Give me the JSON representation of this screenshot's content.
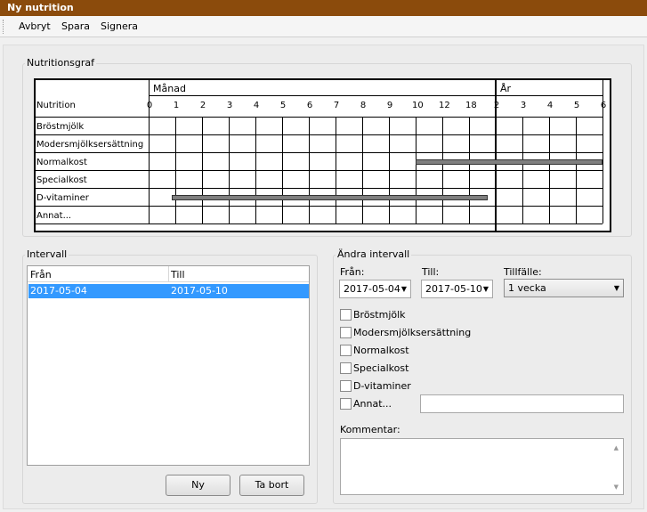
{
  "window": {
    "title": "Ny nutrition"
  },
  "menu": {
    "cancel": "Avbryt",
    "save": "Spara",
    "sign": "Signera"
  },
  "graph": {
    "legend": "Nutritionsgraf",
    "month_header": "Månad",
    "year_header": "År",
    "row_header": "Nutrition",
    "month_ticks": [
      "0",
      "1",
      "2",
      "3",
      "4",
      "5",
      "6",
      "7",
      "8",
      "9",
      "10",
      "12",
      "18"
    ],
    "year_ticks": [
      "2",
      "3",
      "4",
      "5",
      "6"
    ],
    "rows": [
      "Bröstmjölk",
      "Modersmjölksersättning",
      "Normalkost",
      "Specialkost",
      "D-vitaminer",
      "Annat..."
    ]
  },
  "interval": {
    "legend": "Intervall",
    "col_from": "Från",
    "col_to": "Till",
    "rows": [
      {
        "from": "2017-05-04",
        "to": "2017-05-10"
      }
    ],
    "new_button": "Ny",
    "remove_button": "Ta bort"
  },
  "change": {
    "legend": "Ändra intervall",
    "from_label": "Från:",
    "to_label": "Till:",
    "occasion_label": "Tillfälle:",
    "from_value": "2017-05-04",
    "to_value": "2017-05-10",
    "occasion_value": "1 vecka",
    "checks": [
      "Bröstmjölk",
      "Modersmjölksersättning",
      "Normalkost",
      "Specialkost",
      "D-vitaminer",
      "Annat..."
    ],
    "comment_label": "Kommentar:"
  },
  "icons": {
    "dropdown": "chevron-down-icon",
    "scroll_up": "scroll-up-icon",
    "scroll_down": "scroll-down-icon"
  }
}
